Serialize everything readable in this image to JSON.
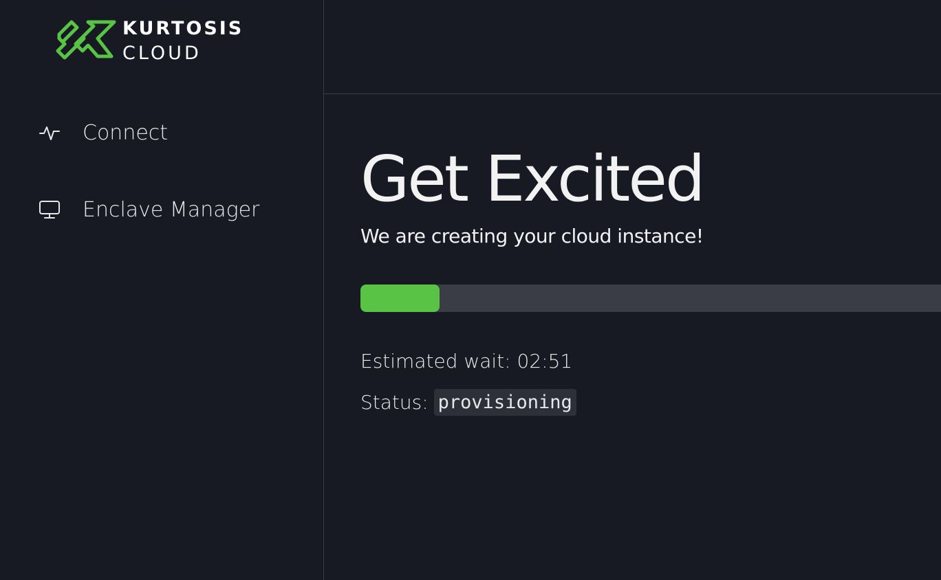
{
  "brand": {
    "line1": "KURTOSIS",
    "line2": "CLOUD",
    "logo_icon": "kurtosis-k-logo",
    "accent_color": "#58c345"
  },
  "sidebar": {
    "items": [
      {
        "label": "Connect",
        "icon": "activity-icon"
      },
      {
        "label": "Enclave Manager",
        "icon": "monitor-icon"
      }
    ]
  },
  "main": {
    "title": "Get Excited",
    "subtitle": "We are creating your cloud instance!",
    "progress_percent": 13.6,
    "wait_label": "Estimated wait: 02:51",
    "status_label": "Status:",
    "status_value": "provisioning"
  }
}
